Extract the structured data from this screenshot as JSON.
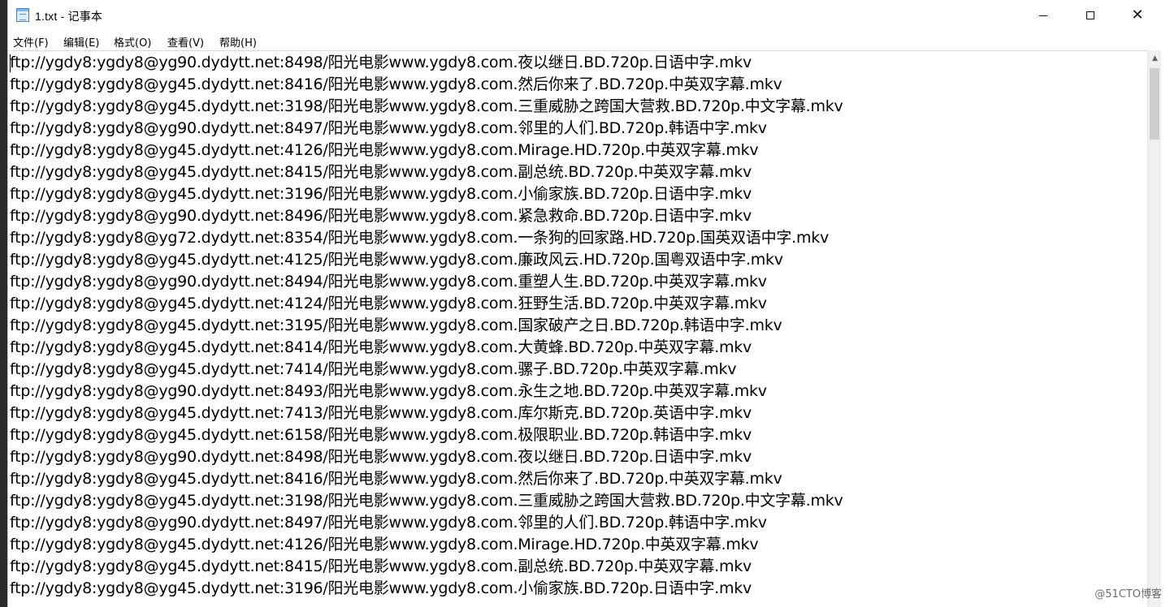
{
  "window": {
    "title": "1.txt - 记事本"
  },
  "menubar": {
    "items": [
      "文件(F)",
      "编辑(E)",
      "格式(O)",
      "查看(V)",
      "帮助(H)"
    ]
  },
  "editor": {
    "lines": [
      "ftp://ygdy8:ygdy8@yg90.dydytt.net:8498/阳光电影www.ygdy8.com.夜以继日.BD.720p.日语中字.mkv",
      "ftp://ygdy8:ygdy8@yg45.dydytt.net:8416/阳光电影www.ygdy8.com.然后你来了.BD.720p.中英双字幕.mkv",
      "ftp://ygdy8:ygdy8@yg45.dydytt.net:3198/阳光电影www.ygdy8.com.三重威胁之跨国大营救.BD.720p.中文字幕.mkv",
      "ftp://ygdy8:ygdy8@yg90.dydytt.net:8497/阳光电影www.ygdy8.com.邻里的人们.BD.720p.韩语中字.mkv",
      "ftp://ygdy8:ygdy8@yg45.dydytt.net:4126/阳光电影www.ygdy8.com.Mirage.HD.720p.中英双字幕.mkv",
      "ftp://ygdy8:ygdy8@yg45.dydytt.net:8415/阳光电影www.ygdy8.com.副总统.BD.720p.中英双字幕.mkv",
      "ftp://ygdy8:ygdy8@yg45.dydytt.net:3196/阳光电影www.ygdy8.com.小偷家族.BD.720p.日语中字.mkv",
      "ftp://ygdy8:ygdy8@yg90.dydytt.net:8496/阳光电影www.ygdy8.com.紧急救命.BD.720p.日语中字.mkv",
      "ftp://ygdy8:ygdy8@yg72.dydytt.net:8354/阳光电影www.ygdy8.com.一条狗的回家路.HD.720p.国英双语中字.mkv",
      "ftp://ygdy8:ygdy8@yg45.dydytt.net:4125/阳光电影www.ygdy8.com.廉政风云.HD.720p.国粤双语中字.mkv",
      "ftp://ygdy8:ygdy8@yg90.dydytt.net:8494/阳光电影www.ygdy8.com.重塑人生.BD.720p.中英双字幕.mkv",
      "ftp://ygdy8:ygdy8@yg45.dydytt.net:4124/阳光电影www.ygdy8.com.狂野生活.BD.720p.中英双字幕.mkv",
      "ftp://ygdy8:ygdy8@yg45.dydytt.net:3195/阳光电影www.ygdy8.com.国家破产之日.BD.720p.韩语中字.mkv",
      "ftp://ygdy8:ygdy8@yg45.dydytt.net:8414/阳光电影www.ygdy8.com.大黄蜂.BD.720p.中英双字幕.mkv",
      "ftp://ygdy8:ygdy8@yg45.dydytt.net:7414/阳光电影www.ygdy8.com.骡子.BD.720p.中英双字幕.mkv",
      "ftp://ygdy8:ygdy8@yg90.dydytt.net:8493/阳光电影www.ygdy8.com.永生之地.BD.720p.中英双字幕.mkv",
      "ftp://ygdy8:ygdy8@yg45.dydytt.net:7413/阳光电影www.ygdy8.com.库尔斯克.BD.720p.英语中字.mkv",
      "ftp://ygdy8:ygdy8@yg45.dydytt.net:6158/阳光电影www.ygdy8.com.极限职业.BD.720p.韩语中字.mkv",
      "ftp://ygdy8:ygdy8@yg90.dydytt.net:8498/阳光电影www.ygdy8.com.夜以继日.BD.720p.日语中字.mkv",
      "ftp://ygdy8:ygdy8@yg45.dydytt.net:8416/阳光电影www.ygdy8.com.然后你来了.BD.720p.中英双字幕.mkv",
      "ftp://ygdy8:ygdy8@yg45.dydytt.net:3198/阳光电影www.ygdy8.com.三重威胁之跨国大营救.BD.720p.中文字幕.mkv",
      "ftp://ygdy8:ygdy8@yg90.dydytt.net:8497/阳光电影www.ygdy8.com.邻里的人们.BD.720p.韩语中字.mkv",
      "ftp://ygdy8:ygdy8@yg45.dydytt.net:4126/阳光电影www.ygdy8.com.Mirage.HD.720p.中英双字幕.mkv",
      "ftp://ygdy8:ygdy8@yg45.dydytt.net:8415/阳光电影www.ygdy8.com.副总统.BD.720p.中英双字幕.mkv",
      "ftp://ygdy8:ygdy8@yg45.dydytt.net:3196/阳光电影www.ygdy8.com.小偷家族.BD.720p.日语中字.mkv"
    ]
  },
  "watermark": "@51CTO博客"
}
